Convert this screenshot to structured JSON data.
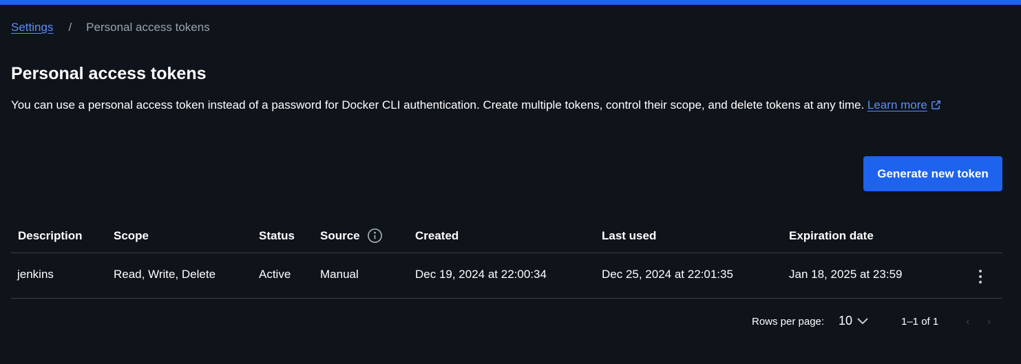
{
  "breadcrumb": {
    "parent": "Settings",
    "separator": "/",
    "current": "Personal access tokens"
  },
  "page": {
    "title": "Personal access tokens",
    "description": "You can use a personal access token instead of a password for Docker CLI authentication. Create multiple tokens, control their scope, and delete tokens at any time. ",
    "learn_more": "Learn more"
  },
  "actions": {
    "generate_label": "Generate new token"
  },
  "table": {
    "headers": {
      "description": "Description",
      "scope": "Scope",
      "status": "Status",
      "source": "Source",
      "created": "Created",
      "last_used": "Last used",
      "expiration": "Expiration date"
    },
    "rows": [
      {
        "description": "jenkins",
        "scope": "Read, Write, Delete",
        "status": "Active",
        "source": "Manual",
        "created": "Dec 19, 2024 at 22:00:34",
        "last_used": "Dec 25, 2024 at 22:01:35",
        "expiration": "Jan 18, 2025 at 23:59"
      }
    ]
  },
  "pagination": {
    "rows_per_page_label": "Rows per page:",
    "rows_per_page_value": "10",
    "range": "1–1 of 1",
    "prev_glyph": "‹",
    "next_glyph": "›"
  },
  "colors": {
    "accent": "#1d63ed",
    "background": "#0f131a",
    "link": "#5a8ff7"
  },
  "icons": [
    "external-link-icon",
    "info-icon",
    "chevron-down-icon",
    "more-vert-icon"
  ]
}
